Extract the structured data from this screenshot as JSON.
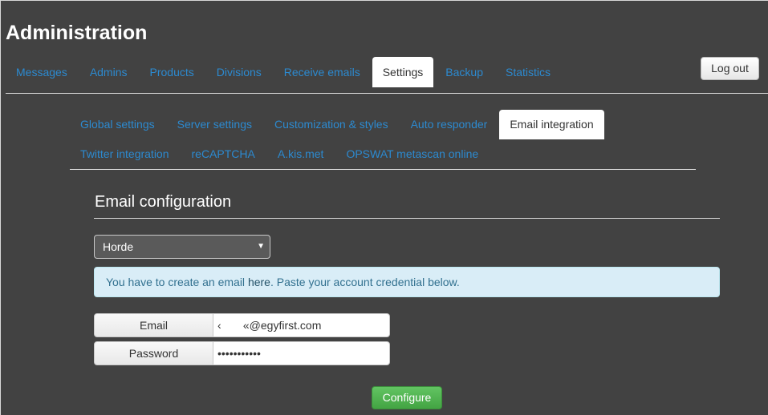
{
  "header": {
    "title": "Administration",
    "logout_label": "Log out"
  },
  "nav": {
    "tabs": [
      {
        "label": "Messages"
      },
      {
        "label": "Admins"
      },
      {
        "label": "Products"
      },
      {
        "label": "Divisions"
      },
      {
        "label": "Receive emails"
      },
      {
        "label": "Settings",
        "active": true
      },
      {
        "label": "Backup"
      },
      {
        "label": "Statistics"
      }
    ]
  },
  "subnav": {
    "row1": [
      {
        "label": "Global settings"
      },
      {
        "label": "Server settings"
      },
      {
        "label": "Customization & styles"
      },
      {
        "label": "Auto responder"
      },
      {
        "label": "Email integration",
        "active": true
      }
    ],
    "row2": [
      {
        "label": "Twitter integration"
      },
      {
        "label": "reCAPTCHA"
      },
      {
        "label": "A.kis.met"
      },
      {
        "label": "OPSWAT metascan online"
      }
    ]
  },
  "email_config": {
    "title": "Email configuration",
    "provider_selected": "Horde",
    "info_text_before": "You have to create an email ",
    "info_link": "here",
    "info_text_after": ". Paste your account credential below.",
    "email_label": "Email",
    "email_value": "‹       «@egyfirst.com",
    "password_label": "Password",
    "password_value": "•••••••••••",
    "configure_label": "Configure"
  },
  "colors": {
    "background": "#424242",
    "link": "#2c8ad0",
    "info_bg": "#d9edf7",
    "success": "#5cb85c"
  }
}
